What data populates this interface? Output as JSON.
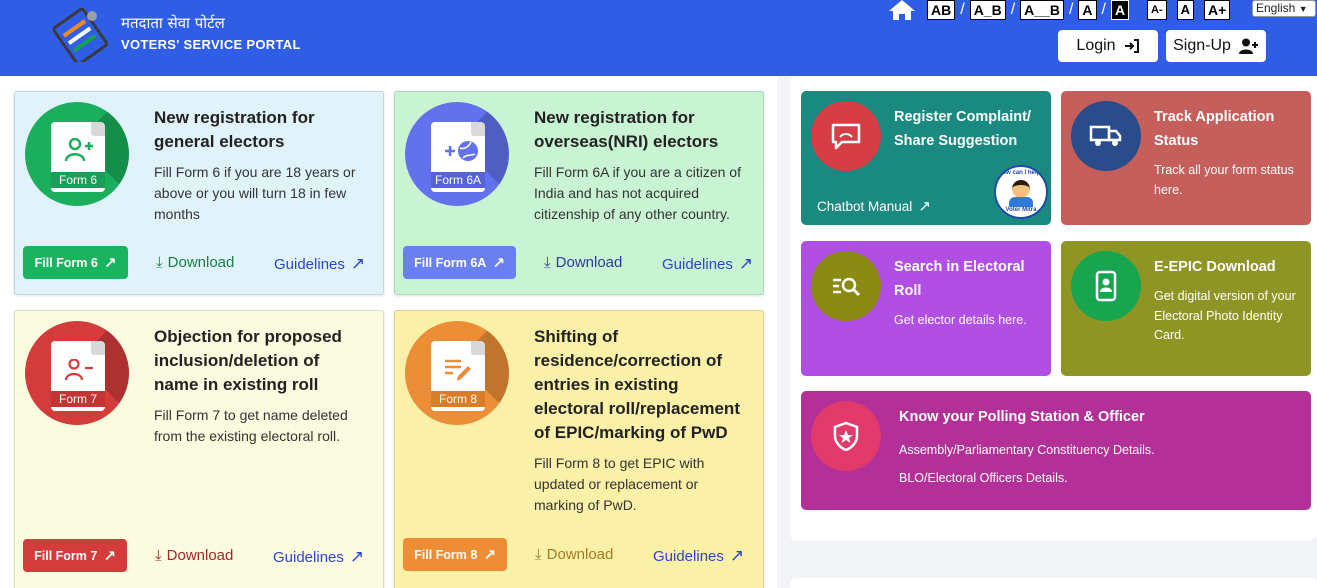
{
  "header": {
    "brand_hindi": "मतदाता सेवा पोर्टल",
    "brand_english": "VOTERS' SERVICE PORTAL",
    "accessibility": [
      "AB",
      "A_B",
      "A__B",
      "A",
      "A",
      "A-",
      "A",
      "A+"
    ],
    "language": "English",
    "login_label": "Login",
    "signup_label": "Sign-Up"
  },
  "forms": [
    {
      "title_line1": "New registration for",
      "title_line2": "general electors",
      "desc_line1": "Fill Form 6 if you are 18 years or",
      "desc_line2": "above or you will turn 18 in few",
      "desc_line3": "months",
      "doc_label": "Form 6",
      "fill_label": "Fill Form 6",
      "download_label": "Download",
      "guidelines_label": "Guidelines"
    },
    {
      "title_line1": "New registration for",
      "title_line2": "overseas(NRI) electors",
      "desc_line1": "Fill Form 6A if you are a citizen of",
      "desc_line2": "India and has not acquired",
      "desc_line3": "citizenship of any other country.",
      "doc_label": "Form 6A",
      "fill_label": "Fill Form 6A",
      "download_label": "Download",
      "guidelines_label": "Guidelines"
    },
    {
      "title_line1": "Objection for proposed",
      "title_line2": "inclusion/deletion of",
      "title_line3": "name in existing roll",
      "desc_line1": "Fill Form 7 to get name deleted",
      "desc_line2": "from the existing electoral roll.",
      "doc_label": "Form 7",
      "fill_label": "Fill Form 7",
      "download_label": "Download",
      "guidelines_label": "Guidelines"
    },
    {
      "title_line1": "Shifting of",
      "title_line2": "residence/correction of",
      "title_line3": "entries in existing",
      "title_line4": "electoral roll/replacement",
      "title_line5": "of EPIC/marking of PwD",
      "desc_line1": "Fill Form 8 to get EPIC with",
      "desc_line2": "updated or replacement or",
      "desc_line3": "marking of PwD.",
      "doc_label": "Form 8",
      "fill_label": "Fill Form 8",
      "download_label": "Download",
      "guidelines_label": "Guidelines"
    }
  ],
  "tiles": {
    "complaint": {
      "title_line1": "Register Complaint/",
      "title_line2": "Share Suggestion",
      "link": "Chatbot Manual",
      "badge_top": "How can I help?",
      "badge_bottom": "Voter Mitra"
    },
    "track": {
      "title_line1": "Track Application",
      "title_line2": "Status",
      "desc_line1": "Track all your form status",
      "desc_line2": "here."
    },
    "search": {
      "title_line1": "Search in Electoral",
      "title_line2": "Roll",
      "desc_line1": "Get elector details here."
    },
    "epic": {
      "title_line1": "E-EPIC Download",
      "desc_line1": "Get digital version of your",
      "desc_line2": "Electoral Photo Identity",
      "desc_line3": "Card."
    },
    "polling": {
      "title_line1": "Know your Polling Station & Officer",
      "desc_line1": "Assembly/Parliamentary Constituency Details.",
      "desc_line2": "BLO/Electoral Officers Details."
    }
  },
  "colors": {
    "header_bg": "#2f5de6",
    "form6_bg": "#e0f3fb",
    "form6_accent": "#1aae5d",
    "form6a_bg": "#c9f4d3",
    "form6a_accent": "#6272ec",
    "form7_bg": "#fbfbdf",
    "form7_accent": "#d43c3c",
    "form8_bg": "#fbf0a8",
    "form8_accent": "#eb8e37",
    "complaint": "#1a8a80",
    "track": "#c45f5c",
    "search": "#b14ee4",
    "epic": "#8f9524",
    "polling": "#b23098"
  }
}
